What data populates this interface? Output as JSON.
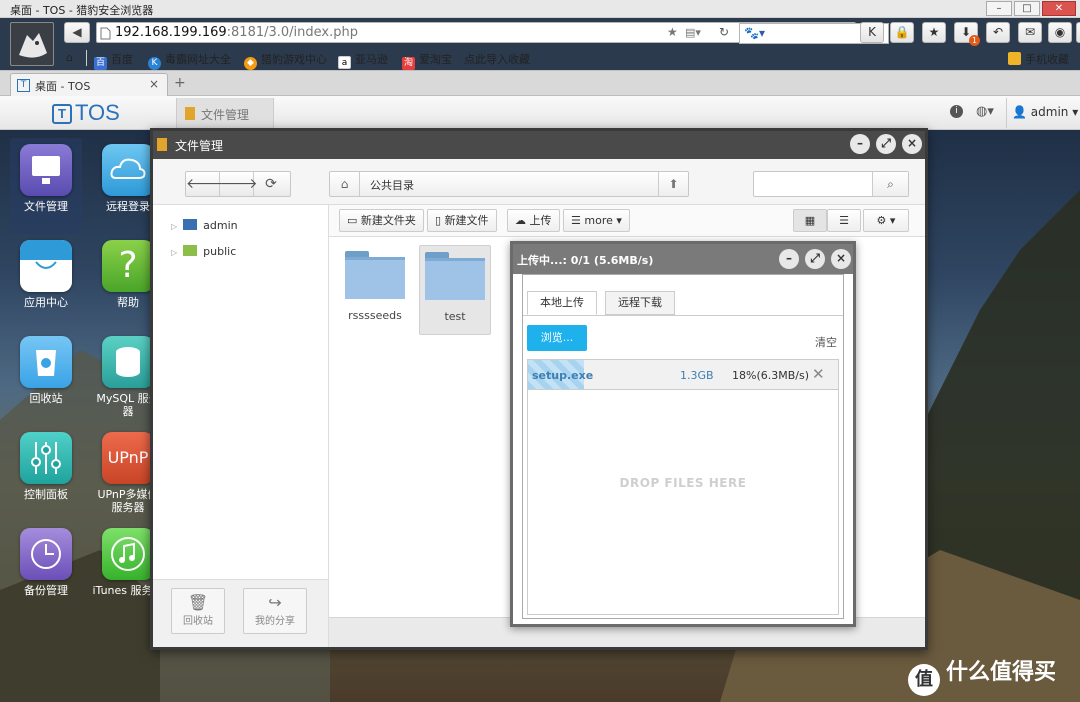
{
  "browser": {
    "window_title": "桌面 - TOS - 猎豹安全浏览器",
    "url_host": "192.168.199.169",
    "url_rest": ":8181/3.0/index.php",
    "bookmarks": [
      "百度",
      "毒霸网址大全",
      "猎豹游戏中心",
      "亚马逊",
      "爱淘宝",
      "点此导入收藏"
    ],
    "mobile_fav": "手机收藏",
    "tab_label": "桌面 - TOS",
    "badge": "1"
  },
  "tos": {
    "logo": "TOS",
    "open_app_tab": "文件管理",
    "user": "admin"
  },
  "desktop_apps": [
    {
      "label": "文件管理"
    },
    {
      "label": "远程登录"
    },
    {
      "label": "应用中心"
    },
    {
      "label": "帮助"
    },
    {
      "label": "回收站"
    },
    {
      "label": "MySQL 服务器"
    },
    {
      "label": "控制面板"
    },
    {
      "label": "UPnP多媒体服务器"
    },
    {
      "label": "备份管理"
    },
    {
      "label": "iTunes 服务器"
    }
  ],
  "file_manager": {
    "title": "文件管理",
    "path": "公共目录",
    "tree": [
      "admin",
      "public"
    ],
    "toolbar": {
      "new_folder": "新建文件夹",
      "new_file": "新建文件",
      "upload": "上传",
      "more": "more"
    },
    "folders": [
      "rsssseeds",
      "test"
    ],
    "bottom": {
      "recycle": "回收站",
      "share": "我的分享"
    }
  },
  "upload_dialog": {
    "title": "上传中...: 0/1 (5.6MB/s)",
    "tabs": [
      "本地上传",
      "远程下载"
    ],
    "browse": "浏览...",
    "clear": "清空",
    "file": {
      "name": "setup.exe",
      "size": "1.3GB",
      "progress": "18%(6.3MB/s)",
      "percent": 18
    },
    "drop_hint": "DROP FILES HERE"
  },
  "watermark": "什么值得买",
  "colors": {
    "accent": "#1fb1ec",
    "tos_blue": "#2b72b8"
  }
}
